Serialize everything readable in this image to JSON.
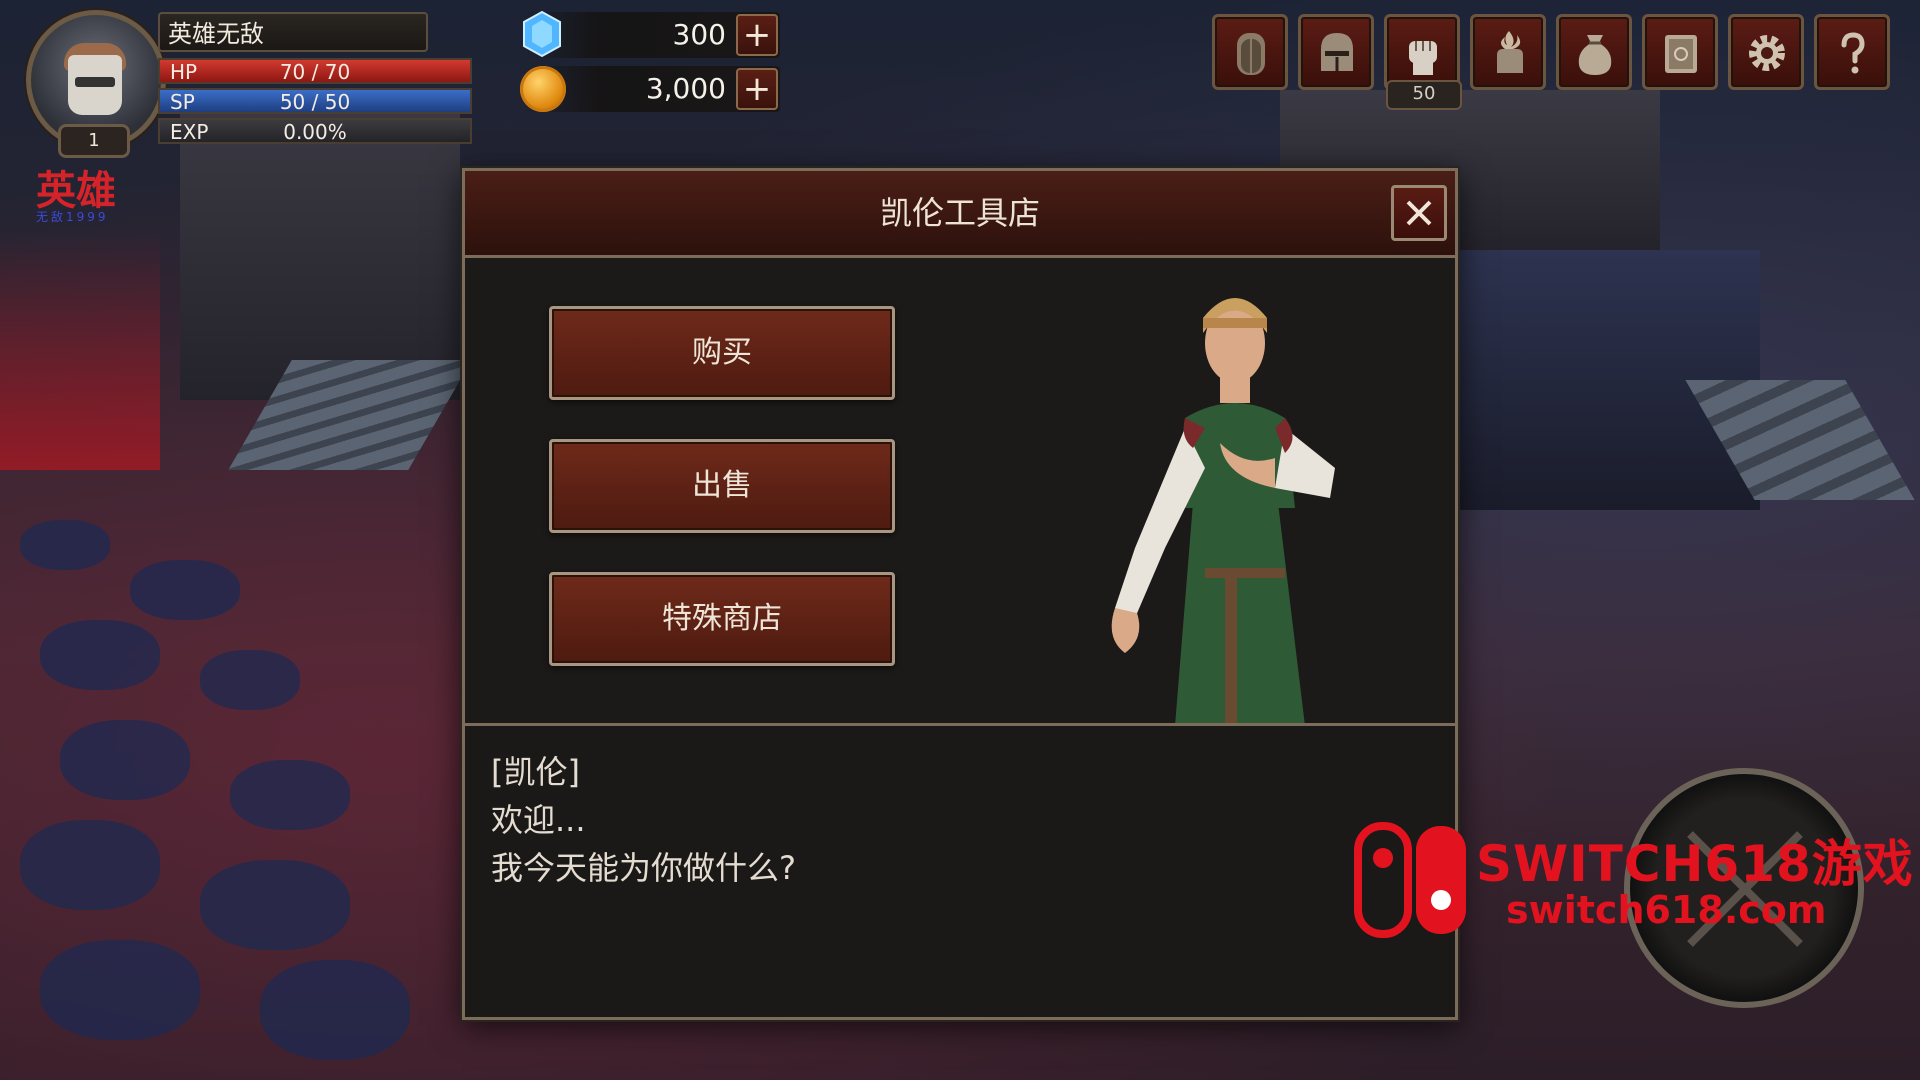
{
  "player": {
    "name": "英雄无敌",
    "level": "1",
    "hp_label": "HP",
    "hp_value": "70 / 70",
    "sp_label": "SP",
    "sp_value": "50 / 50",
    "exp_label": "EXP",
    "exp_value": "0.00%"
  },
  "logo": {
    "title": "英雄",
    "subtitle": "无敌1999"
  },
  "currency": {
    "gems": "300",
    "gold": "3,000",
    "plus_label": "+"
  },
  "menu": {
    "skills_badge": "50",
    "icons": [
      "door-icon",
      "helmet-icon",
      "fist-icon",
      "fire-hand-icon",
      "bag-icon",
      "book-icon",
      "gear-icon",
      "help-icon"
    ]
  },
  "dialog": {
    "title": "凯伦工具店",
    "buttons": {
      "buy": "购买",
      "sell": "出售",
      "special": "特殊商店"
    },
    "speaker": "[凯伦]",
    "line1": "欢迎...",
    "line2": "我今天能为你做什么?"
  },
  "watermark": {
    "brand": "SWITCH618游戏",
    "url": "switch618.com"
  },
  "colors": {
    "accent_red": "#6e2a1a",
    "hp": "#d23a30",
    "sp": "#3a6ec8",
    "watermark": "#e2131e"
  }
}
